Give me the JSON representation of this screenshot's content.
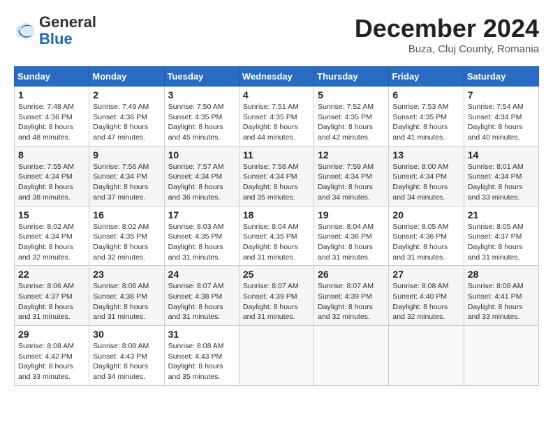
{
  "header": {
    "logo_general": "General",
    "logo_blue": "Blue",
    "month_title": "December 2024",
    "location": "Buza, Cluj County, Romania"
  },
  "weekdays": [
    "Sunday",
    "Monday",
    "Tuesday",
    "Wednesday",
    "Thursday",
    "Friday",
    "Saturday"
  ],
  "weeks": [
    [
      {
        "day": 1,
        "sunrise": "7:48 AM",
        "sunset": "4:36 PM",
        "daylight": "8 hours and 48 minutes."
      },
      {
        "day": 2,
        "sunrise": "7:49 AM",
        "sunset": "4:36 PM",
        "daylight": "8 hours and 47 minutes."
      },
      {
        "day": 3,
        "sunrise": "7:50 AM",
        "sunset": "4:35 PM",
        "daylight": "8 hours and 45 minutes."
      },
      {
        "day": 4,
        "sunrise": "7:51 AM",
        "sunset": "4:35 PM",
        "daylight": "8 hours and 44 minutes."
      },
      {
        "day": 5,
        "sunrise": "7:52 AM",
        "sunset": "4:35 PM",
        "daylight": "8 hours and 42 minutes."
      },
      {
        "day": 6,
        "sunrise": "7:53 AM",
        "sunset": "4:35 PM",
        "daylight": "8 hours and 41 minutes."
      },
      {
        "day": 7,
        "sunrise": "7:54 AM",
        "sunset": "4:34 PM",
        "daylight": "8 hours and 40 minutes."
      }
    ],
    [
      {
        "day": 8,
        "sunrise": "7:55 AM",
        "sunset": "4:34 PM",
        "daylight": "8 hours and 38 minutes."
      },
      {
        "day": 9,
        "sunrise": "7:56 AM",
        "sunset": "4:34 PM",
        "daylight": "8 hours and 37 minutes."
      },
      {
        "day": 10,
        "sunrise": "7:57 AM",
        "sunset": "4:34 PM",
        "daylight": "8 hours and 36 minutes."
      },
      {
        "day": 11,
        "sunrise": "7:58 AM",
        "sunset": "4:34 PM",
        "daylight": "8 hours and 35 minutes."
      },
      {
        "day": 12,
        "sunrise": "7:59 AM",
        "sunset": "4:34 PM",
        "daylight": "8 hours and 34 minutes."
      },
      {
        "day": 13,
        "sunrise": "8:00 AM",
        "sunset": "4:34 PM",
        "daylight": "8 hours and 34 minutes."
      },
      {
        "day": 14,
        "sunrise": "8:01 AM",
        "sunset": "4:34 PM",
        "daylight": "8 hours and 33 minutes."
      }
    ],
    [
      {
        "day": 15,
        "sunrise": "8:02 AM",
        "sunset": "4:34 PM",
        "daylight": "8 hours and 32 minutes."
      },
      {
        "day": 16,
        "sunrise": "8:02 AM",
        "sunset": "4:35 PM",
        "daylight": "8 hours and 32 minutes."
      },
      {
        "day": 17,
        "sunrise": "8:03 AM",
        "sunset": "4:35 PM",
        "daylight": "8 hours and 31 minutes."
      },
      {
        "day": 18,
        "sunrise": "8:04 AM",
        "sunset": "4:35 PM",
        "daylight": "8 hours and 31 minutes."
      },
      {
        "day": 19,
        "sunrise": "8:04 AM",
        "sunset": "4:36 PM",
        "daylight": "8 hours and 31 minutes."
      },
      {
        "day": 20,
        "sunrise": "8:05 AM",
        "sunset": "4:36 PM",
        "daylight": "8 hours and 31 minutes."
      },
      {
        "day": 21,
        "sunrise": "8:05 AM",
        "sunset": "4:37 PM",
        "daylight": "8 hours and 31 minutes."
      }
    ],
    [
      {
        "day": 22,
        "sunrise": "8:06 AM",
        "sunset": "4:37 PM",
        "daylight": "8 hours and 31 minutes."
      },
      {
        "day": 23,
        "sunrise": "8:06 AM",
        "sunset": "4:38 PM",
        "daylight": "8 hours and 31 minutes."
      },
      {
        "day": 24,
        "sunrise": "8:07 AM",
        "sunset": "4:38 PM",
        "daylight": "8 hours and 31 minutes."
      },
      {
        "day": 25,
        "sunrise": "8:07 AM",
        "sunset": "4:39 PM",
        "daylight": "8 hours and 31 minutes."
      },
      {
        "day": 26,
        "sunrise": "8:07 AM",
        "sunset": "4:39 PM",
        "daylight": "8 hours and 32 minutes."
      },
      {
        "day": 27,
        "sunrise": "8:08 AM",
        "sunset": "4:40 PM",
        "daylight": "8 hours and 32 minutes."
      },
      {
        "day": 28,
        "sunrise": "8:08 AM",
        "sunset": "4:41 PM",
        "daylight": "8 hours and 33 minutes."
      }
    ],
    [
      {
        "day": 29,
        "sunrise": "8:08 AM",
        "sunset": "4:42 PM",
        "daylight": "8 hours and 33 minutes."
      },
      {
        "day": 30,
        "sunrise": "8:08 AM",
        "sunset": "4:43 PM",
        "daylight": "8 hours and 34 minutes."
      },
      {
        "day": 31,
        "sunrise": "8:08 AM",
        "sunset": "4:43 PM",
        "daylight": "8 hours and 35 minutes."
      },
      null,
      null,
      null,
      null
    ]
  ]
}
